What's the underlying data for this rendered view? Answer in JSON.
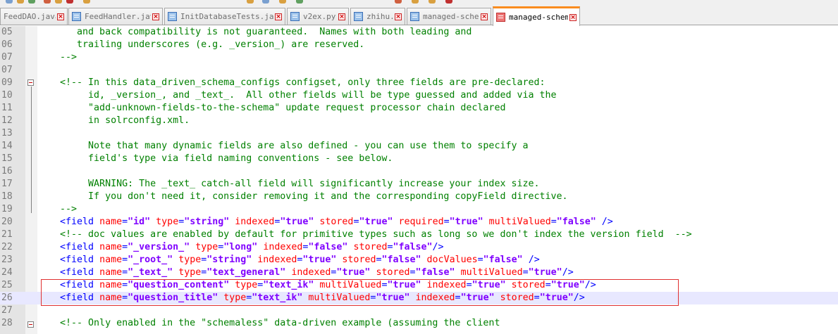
{
  "tabs": [
    {
      "label": "FeedDAO.java",
      "icon": "java-file-icon",
      "active": false
    },
    {
      "label": "FeedHandler.java",
      "icon": "java-file-icon",
      "active": false
    },
    {
      "label": "InitDatabaseTests.java",
      "icon": "java-file-icon",
      "active": false
    },
    {
      "label": "v2ex.py",
      "icon": "python-file-icon",
      "active": false
    },
    {
      "label": "zhihu.py",
      "icon": "python-file-icon",
      "active": false
    },
    {
      "label": "managed-schema",
      "icon": "file-icon",
      "active": false
    },
    {
      "label": "managed-schema",
      "icon": "modified-file-icon",
      "active": true
    }
  ],
  "editor": {
    "lines": [
      {
        "n": "05",
        "segs": [
          [
            "c",
            "       and back compatibility is not guaranteed.  Names with both leading and"
          ]
        ]
      },
      {
        "n": "06",
        "segs": [
          [
            "c",
            "       trailing underscores (e.g. _version_) are reserved."
          ]
        ]
      },
      {
        "n": "07",
        "segs": [
          [
            "c",
            "    -->"
          ]
        ]
      },
      {
        "n": "07",
        "segs": []
      },
      {
        "n": "09",
        "segs": [
          [
            "c",
            "    <!-- In this data_driven_schema_configs configset, only three fields are pre-declared:"
          ]
        ]
      },
      {
        "n": "10",
        "segs": [
          [
            "c",
            "         id, _version_, and _text_.  All other fields will be type guessed and added via the"
          ]
        ]
      },
      {
        "n": "11",
        "segs": [
          [
            "c",
            "         \"add-unknown-fields-to-the-schema\" update request processor chain declared"
          ]
        ]
      },
      {
        "n": "12",
        "segs": [
          [
            "c",
            "         in solrconfig.xml."
          ]
        ]
      },
      {
        "n": "13",
        "segs": []
      },
      {
        "n": "14",
        "segs": [
          [
            "c",
            "         Note that many dynamic fields are also defined - you can use them to specify a"
          ]
        ]
      },
      {
        "n": "15",
        "segs": [
          [
            "c",
            "         field's type via field naming conventions - see below."
          ]
        ]
      },
      {
        "n": "16",
        "segs": []
      },
      {
        "n": "17",
        "segs": [
          [
            "c",
            "         WARNING: The _text_ catch-all field will significantly increase your index size."
          ]
        ]
      },
      {
        "n": "18",
        "segs": [
          [
            "c",
            "         If you don't need it, consider removing it and the corresponding copyField directive."
          ]
        ]
      },
      {
        "n": "19",
        "segs": [
          [
            "c",
            "    -->"
          ]
        ]
      },
      {
        "n": "20",
        "segs": [
          [
            "p",
            "    "
          ],
          [
            "t",
            "<field "
          ],
          [
            "a",
            "name"
          ],
          [
            "t",
            "="
          ],
          [
            "v",
            "\"id\""
          ],
          [
            "p",
            " "
          ],
          [
            "a",
            "type"
          ],
          [
            "t",
            "="
          ],
          [
            "v",
            "\"string\""
          ],
          [
            "p",
            " "
          ],
          [
            "a",
            "indexed"
          ],
          [
            "t",
            "="
          ],
          [
            "v",
            "\"true\""
          ],
          [
            "p",
            " "
          ],
          [
            "a",
            "stored"
          ],
          [
            "t",
            "="
          ],
          [
            "v",
            "\"true\""
          ],
          [
            "p",
            " "
          ],
          [
            "a",
            "required"
          ],
          [
            "t",
            "="
          ],
          [
            "v",
            "\"true\""
          ],
          [
            "p",
            " "
          ],
          [
            "a",
            "multiValued"
          ],
          [
            "t",
            "="
          ],
          [
            "v",
            "\"false\""
          ],
          [
            "p",
            " "
          ],
          [
            "t",
            "/>"
          ]
        ]
      },
      {
        "n": "21",
        "segs": [
          [
            "c",
            "    <!-- doc values are enabled by default for primitive types such as long so we don't index the version field  -->"
          ]
        ]
      },
      {
        "n": "22",
        "segs": [
          [
            "p",
            "    "
          ],
          [
            "t",
            "<field "
          ],
          [
            "a",
            "name"
          ],
          [
            "t",
            "="
          ],
          [
            "v",
            "\"_version_\""
          ],
          [
            "p",
            " "
          ],
          [
            "a",
            "type"
          ],
          [
            "t",
            "="
          ],
          [
            "v",
            "\"long\""
          ],
          [
            "p",
            " "
          ],
          [
            "a",
            "indexed"
          ],
          [
            "t",
            "="
          ],
          [
            "v",
            "\"false\""
          ],
          [
            "p",
            " "
          ],
          [
            "a",
            "stored"
          ],
          [
            "t",
            "="
          ],
          [
            "v",
            "\"false\""
          ],
          [
            "t",
            "/>"
          ]
        ]
      },
      {
        "n": "23",
        "segs": [
          [
            "p",
            "    "
          ],
          [
            "t",
            "<field "
          ],
          [
            "a",
            "name"
          ],
          [
            "t",
            "="
          ],
          [
            "v",
            "\"_root_\""
          ],
          [
            "p",
            " "
          ],
          [
            "a",
            "type"
          ],
          [
            "t",
            "="
          ],
          [
            "v",
            "\"string\""
          ],
          [
            "p",
            " "
          ],
          [
            "a",
            "indexed"
          ],
          [
            "t",
            "="
          ],
          [
            "v",
            "\"true\""
          ],
          [
            "p",
            " "
          ],
          [
            "a",
            "stored"
          ],
          [
            "t",
            "="
          ],
          [
            "v",
            "\"false\""
          ],
          [
            "p",
            " "
          ],
          [
            "a",
            "docValues"
          ],
          [
            "t",
            "="
          ],
          [
            "v",
            "\"false\""
          ],
          [
            "p",
            " "
          ],
          [
            "t",
            "/>"
          ]
        ]
      },
      {
        "n": "24",
        "segs": [
          [
            "p",
            "    "
          ],
          [
            "t",
            "<field "
          ],
          [
            "a",
            "name"
          ],
          [
            "t",
            "="
          ],
          [
            "v",
            "\"_text_\""
          ],
          [
            "p",
            " "
          ],
          [
            "a",
            "type"
          ],
          [
            "t",
            "="
          ],
          [
            "v",
            "\"text_general\""
          ],
          [
            "p",
            " "
          ],
          [
            "a",
            "indexed"
          ],
          [
            "t",
            "="
          ],
          [
            "v",
            "\"true\""
          ],
          [
            "p",
            " "
          ],
          [
            "a",
            "stored"
          ],
          [
            "t",
            "="
          ],
          [
            "v",
            "\"false\""
          ],
          [
            "p",
            " "
          ],
          [
            "a",
            "multiValued"
          ],
          [
            "t",
            "="
          ],
          [
            "v",
            "\"true\""
          ],
          [
            "t",
            "/>"
          ]
        ]
      },
      {
        "n": "25",
        "segs": [
          [
            "p",
            "    "
          ],
          [
            "t",
            "<field "
          ],
          [
            "a",
            "name"
          ],
          [
            "t",
            "="
          ],
          [
            "v",
            "\"question_content\""
          ],
          [
            "p",
            " "
          ],
          [
            "a",
            "type"
          ],
          [
            "t",
            "="
          ],
          [
            "v",
            "\"text_ik\""
          ],
          [
            "p",
            " "
          ],
          [
            "a",
            "multiValued"
          ],
          [
            "t",
            "="
          ],
          [
            "v",
            "\"true\""
          ],
          [
            "p",
            " "
          ],
          [
            "a",
            "indexed"
          ],
          [
            "t",
            "="
          ],
          [
            "v",
            "\"true\""
          ],
          [
            "p",
            " "
          ],
          [
            "a",
            "stored"
          ],
          [
            "t",
            "="
          ],
          [
            "v",
            "\"true\""
          ],
          [
            "t",
            "/>"
          ]
        ]
      },
      {
        "n": "26",
        "segs": [
          [
            "p",
            "    "
          ],
          [
            "t",
            "<field "
          ],
          [
            "a",
            "name"
          ],
          [
            "t",
            "="
          ],
          [
            "v",
            "\"question_title\""
          ],
          [
            "p",
            " "
          ],
          [
            "a",
            "type"
          ],
          [
            "t",
            "="
          ],
          [
            "v",
            "\"text_ik\""
          ],
          [
            "p",
            " "
          ],
          [
            "a",
            "multiValued"
          ],
          [
            "t",
            "="
          ],
          [
            "v",
            "\"true\""
          ],
          [
            "p",
            " "
          ],
          [
            "a",
            "indexed"
          ],
          [
            "t",
            "="
          ],
          [
            "v",
            "\"true\""
          ],
          [
            "p",
            " "
          ],
          [
            "a",
            "stored"
          ],
          [
            "t",
            "="
          ],
          [
            "v",
            "\"true\""
          ],
          [
            "t",
            "/>"
          ]
        ]
      },
      {
        "n": "27",
        "segs": []
      },
      {
        "n": "28",
        "segs": [
          [
            "c",
            "    <!-- Only enabled in the \"schemaless\" data-driven example (assuming the client"
          ]
        ]
      }
    ],
    "current_line": "26"
  },
  "colors": {
    "comment": "#008000",
    "tag": "#0000ff",
    "attribute": "#ff0000",
    "value": "#8000ff",
    "active_tab_accent": "#fa8c1e",
    "highlight_box": "#e03030",
    "current_line_bg": "#e8e8ff"
  }
}
